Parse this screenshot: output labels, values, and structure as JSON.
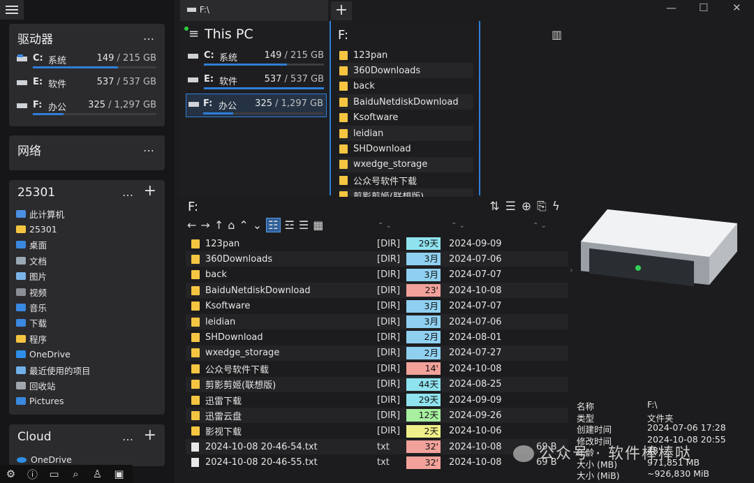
{
  "tab": {
    "title": "F:\\"
  },
  "drives_card": {
    "title": "驱动器",
    "drives": [
      {
        "letter": "C:",
        "name": "系统",
        "used": "149",
        "total": "/ 215 GB",
        "fill": 0.69
      },
      {
        "letter": "E:",
        "name": "软件",
        "used": "537",
        "total": "/ 537 GB",
        "fill": 1.0
      },
      {
        "letter": "F:",
        "name": "办公",
        "used": "325",
        "total": "/ 1,297 GB",
        "fill": 0.25
      }
    ]
  },
  "network_card": {
    "title": "网络"
  },
  "pc_card": {
    "title": "25301",
    "items": [
      "此计算机",
      "25301",
      "桌面",
      "文档",
      "图片",
      "视频",
      "音乐",
      "下载",
      "程序",
      "OneDrive",
      "最近使用的项目",
      "回收站",
      "Pictures"
    ]
  },
  "cloud_card": {
    "title": "Cloud",
    "items": [
      "OneDrive"
    ]
  },
  "thispc": {
    "title": "This PC",
    "drives": [
      {
        "letter": "C:",
        "name": "系统",
        "used": "149",
        "total": "/ 215 GB",
        "fill": 0.69
      },
      {
        "letter": "E:",
        "name": "软件",
        "used": "537",
        "total": "/ 537 GB",
        "fill": 1.0
      },
      {
        "letter": "F:",
        "name": "办公",
        "used": "325",
        "total": "/ 1,297 GB",
        "fill": 0.25
      }
    ]
  },
  "fdrop": {
    "title": "F:",
    "items": [
      "123pan",
      "360Downloads",
      "back",
      "BaiduNetdiskDownload",
      "Ksoftware",
      "leidian",
      "SHDownload",
      "wxedge_storage",
      "公众号软件下载",
      "剪影剪姬(联想版)"
    ]
  },
  "main": {
    "title": "F:",
    "rows": [
      {
        "name": "123pan",
        "type": "[DIR]",
        "age": "29天",
        "color": "#8fe3ef",
        "date": "2024-09-09",
        "size": "",
        "file": false
      },
      {
        "name": "360Downloads",
        "type": "[DIR]",
        "age": "3月",
        "color": "#8fd0f0",
        "date": "2024-07-06",
        "size": "",
        "file": false
      },
      {
        "name": "back",
        "type": "[DIR]",
        "age": "3月",
        "color": "#8fd0f0",
        "date": "2024-07-07",
        "size": "",
        "file": false
      },
      {
        "name": "BaiduNetdiskDownload",
        "type": "[DIR]",
        "age": "23'",
        "color": "#f2a29a",
        "date": "2024-10-08",
        "size": "",
        "file": false
      },
      {
        "name": "Ksoftware",
        "type": "[DIR]",
        "age": "3月",
        "color": "#8fd0f0",
        "date": "2024-07-07",
        "size": "",
        "file": false
      },
      {
        "name": "leidian",
        "type": "[DIR]",
        "age": "3月",
        "color": "#8fd0f0",
        "date": "2024-07-06",
        "size": "",
        "file": false
      },
      {
        "name": "SHDownload",
        "type": "[DIR]",
        "age": "2月",
        "color": "#8fd0f0",
        "date": "2024-08-01",
        "size": "",
        "file": false
      },
      {
        "name": "wxedge_storage",
        "type": "[DIR]",
        "age": "2月",
        "color": "#8fd0f0",
        "date": "2024-07-27",
        "size": "",
        "file": false
      },
      {
        "name": "公众号软件下载",
        "type": "[DIR]",
        "age": "14'",
        "color": "#f2a29a",
        "date": "2024-10-08",
        "size": "",
        "file": false
      },
      {
        "name": "剪影剪姬(联想版)",
        "type": "[DIR]",
        "age": "44天",
        "color": "#8fe3ef",
        "date": "2024-08-25",
        "size": "",
        "file": false
      },
      {
        "name": "迅雷下载",
        "type": "[DIR]",
        "age": "29天",
        "color": "#8fe3ef",
        "date": "2024-09-09",
        "size": "",
        "file": false
      },
      {
        "name": "迅雷云盘",
        "type": "[DIR]",
        "age": "12天",
        "color": "#a8f0a0",
        "date": "2024-09-26",
        "size": "",
        "file": false
      },
      {
        "name": "影视下载",
        "type": "[DIR]",
        "age": "2天",
        "color": "#f0f08a",
        "date": "2024-10-06",
        "size": "",
        "file": false
      },
      {
        "name": "2024-10-08 20-46-54.txt",
        "type": "txt",
        "age": "32'",
        "color": "#f2a29a",
        "date": "2024-10-08",
        "size": "69 B",
        "file": true
      },
      {
        "name": "2024-10-08 20-46-55.txt",
        "type": "txt",
        "age": "32'",
        "color": "#f2a29a",
        "date": "2024-10-08",
        "size": "69 B",
        "file": true
      }
    ]
  },
  "props": [
    {
      "k": "名称",
      "v": "F:\\"
    },
    {
      "k": "类型",
      "v": "文件夹"
    },
    {
      "k": "创建时间",
      "v": "2024-07-06  17:28"
    },
    {
      "k": "修改时间",
      "v": "2024-10-08  20:55"
    },
    {
      "k": "年龄",
      "v": "48'"
    },
    {
      "k": "大小 (MB)",
      "v": "971,851 MB"
    },
    {
      "k": "大小 (MiB)",
      "v": "~926,830 MiB"
    }
  ],
  "watermark": "公众号 · 软件棒棒哒",
  "colors": {
    "accent": "#2f7fd8",
    "folder": "#f5c542"
  }
}
